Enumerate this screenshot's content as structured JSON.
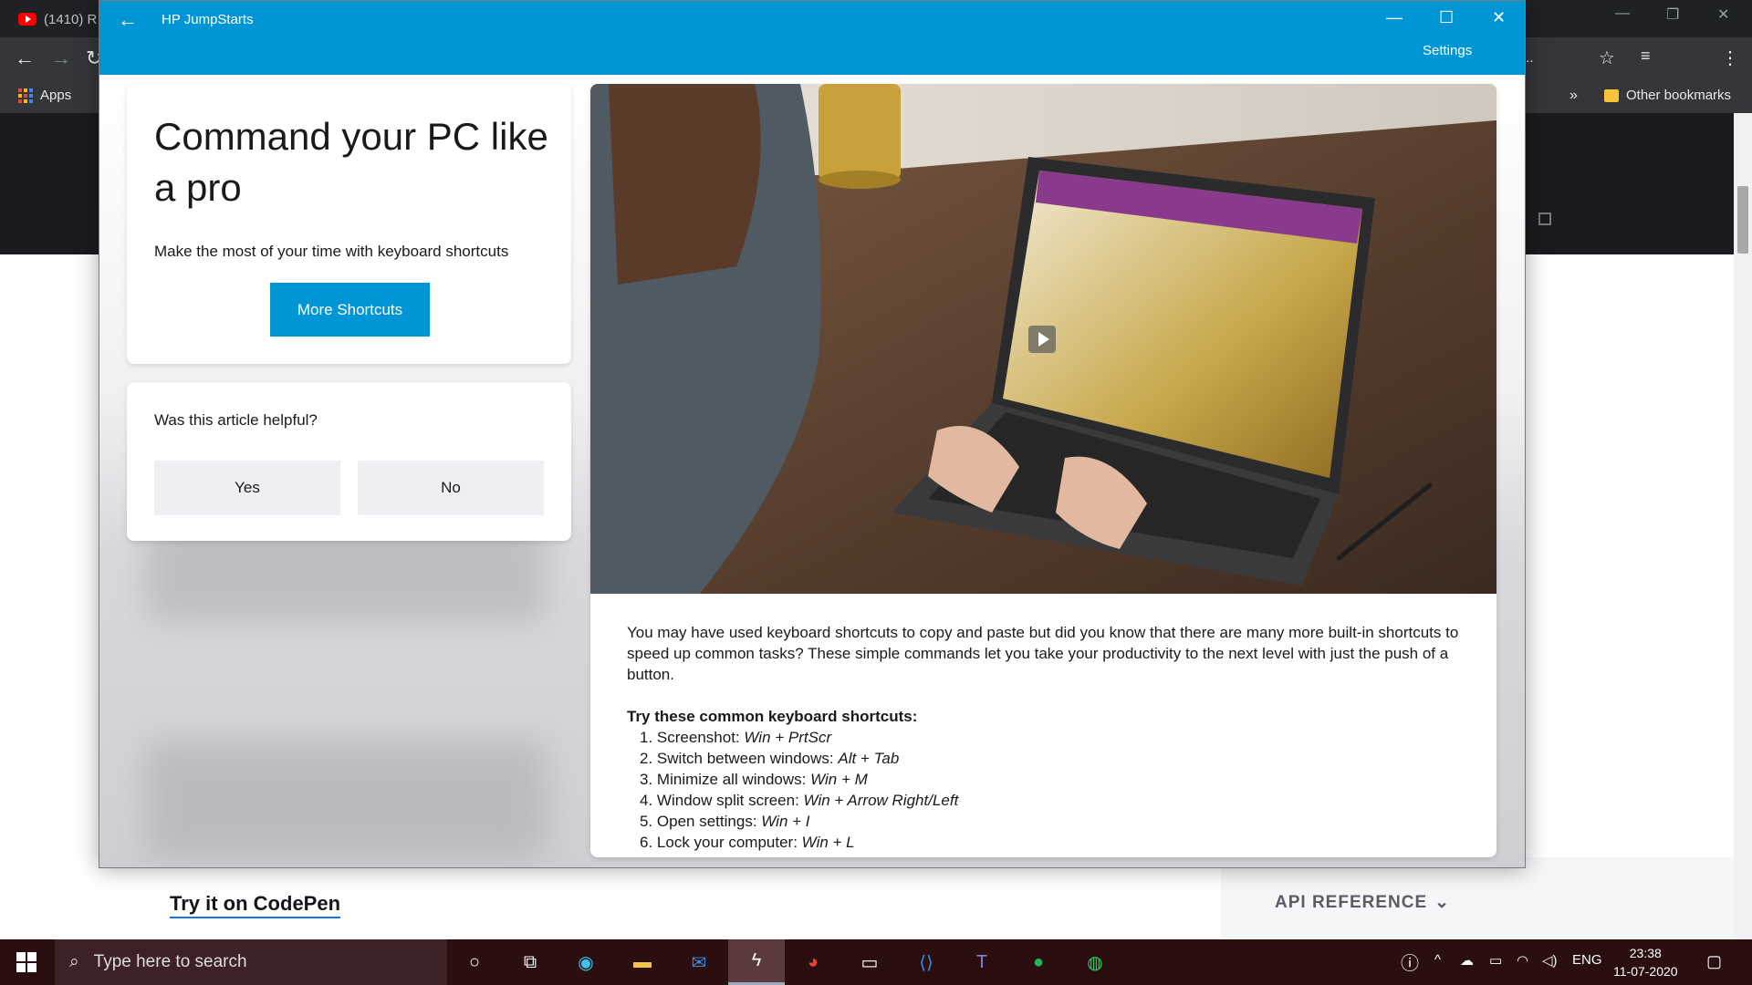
{
  "browser": {
    "tab_title": "(1410) R",
    "bookmarks": {
      "apps_label": "Apps",
      "more_label": "»",
      "other_label": "Other bookmarks"
    },
    "toolbar_more": "..."
  },
  "page": {
    "codepen_link": "Try it on CodePen",
    "api_reference": "API REFERENCE"
  },
  "hp_window": {
    "app_name": "HP JumpStarts",
    "settings_label": "Settings",
    "command_card": {
      "title": "Command your PC like a pro",
      "subtitle": "Make the most of your time with keyboard shortcuts",
      "button_label": "More Shortcuts"
    },
    "helpful_card": {
      "question": "Was this article helpful?",
      "yes_label": "Yes",
      "no_label": "No"
    },
    "article": {
      "intro": "You may have used keyboard shortcuts to copy and paste but did you know that there are many more built-in shortcuts to speed up common tasks? These simple commands let you take your productivity to the next level with just the push of a button.",
      "shortcuts_heading": "Try these common keyboard shortcuts:",
      "shortcuts": [
        {
          "num": "1.",
          "label": "Screenshot:",
          "keys": "Win + PrtScr"
        },
        {
          "num": "2.",
          "label": "Switch between windows:",
          "keys": "Alt + Tab"
        },
        {
          "num": "3.",
          "label": "Minimize all windows:",
          "keys": "Win + M"
        },
        {
          "num": "4.",
          "label": "Window split screen:",
          "keys": "Win + Arrow Right/Left"
        },
        {
          "num": "5.",
          "label": "Open settings:",
          "keys": "Win + I"
        },
        {
          "num": "6.",
          "label": "Lock your computer:",
          "keys": "Win + L"
        }
      ]
    }
  },
  "taskbar": {
    "search_placeholder": "Type here to search",
    "language": "ENG",
    "time": "23:38",
    "date": "11-07-2020"
  },
  "colors": {
    "hp_blue": "#0096d6",
    "taskbar_bg": "#2b0e10",
    "chrome_dark": "#35363a"
  }
}
